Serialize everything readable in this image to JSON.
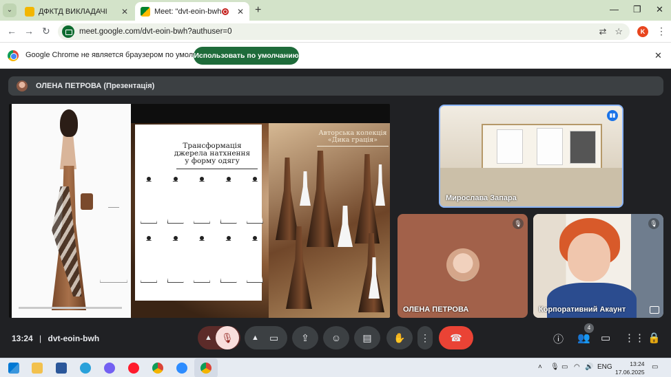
{
  "browser": {
    "tabs": [
      {
        "title": "ДФКТД ВИКЛАДАЧІ",
        "active": false
      },
      {
        "title": "Meet: \"dvt-eoin-bwh\"",
        "active": true
      }
    ],
    "url": "meet.google.com/dvt-eoin-bwh?authuser=0",
    "profile_initial": "K"
  },
  "infobar": {
    "message": "Google Chrome не является браузером по умолчанию.",
    "button_label": "Использовать по умолчанию"
  },
  "meet": {
    "presenter_label": "ОЛЕНА ПЕТРОВА (Презентація)",
    "slide": {
      "left_title": "Трансформація джерела натхнення у форму одягу",
      "right_title": "Авторська колекція «Дика грація»"
    },
    "participants": [
      {
        "name": "Мирослава Запара",
        "speaking": true
      },
      {
        "name": "ОЛЕНА ПЕТРОВА",
        "muted": true
      },
      {
        "name": "Корпоративний Акаунт",
        "muted": true
      }
    ],
    "meeting_time": "13:24",
    "meeting_code": "dvt-eoin-bwh",
    "people_count": "4"
  },
  "taskbar": {
    "language": "ENG",
    "time": "13:24",
    "date": "17.06.2025"
  },
  "colors": {
    "tabstrip": "#d3e3c9",
    "infobar_button": "#1e6b3a",
    "meet_bg": "#202124",
    "end_call": "#ea4335",
    "active_speaker": "#8ab4f8"
  }
}
